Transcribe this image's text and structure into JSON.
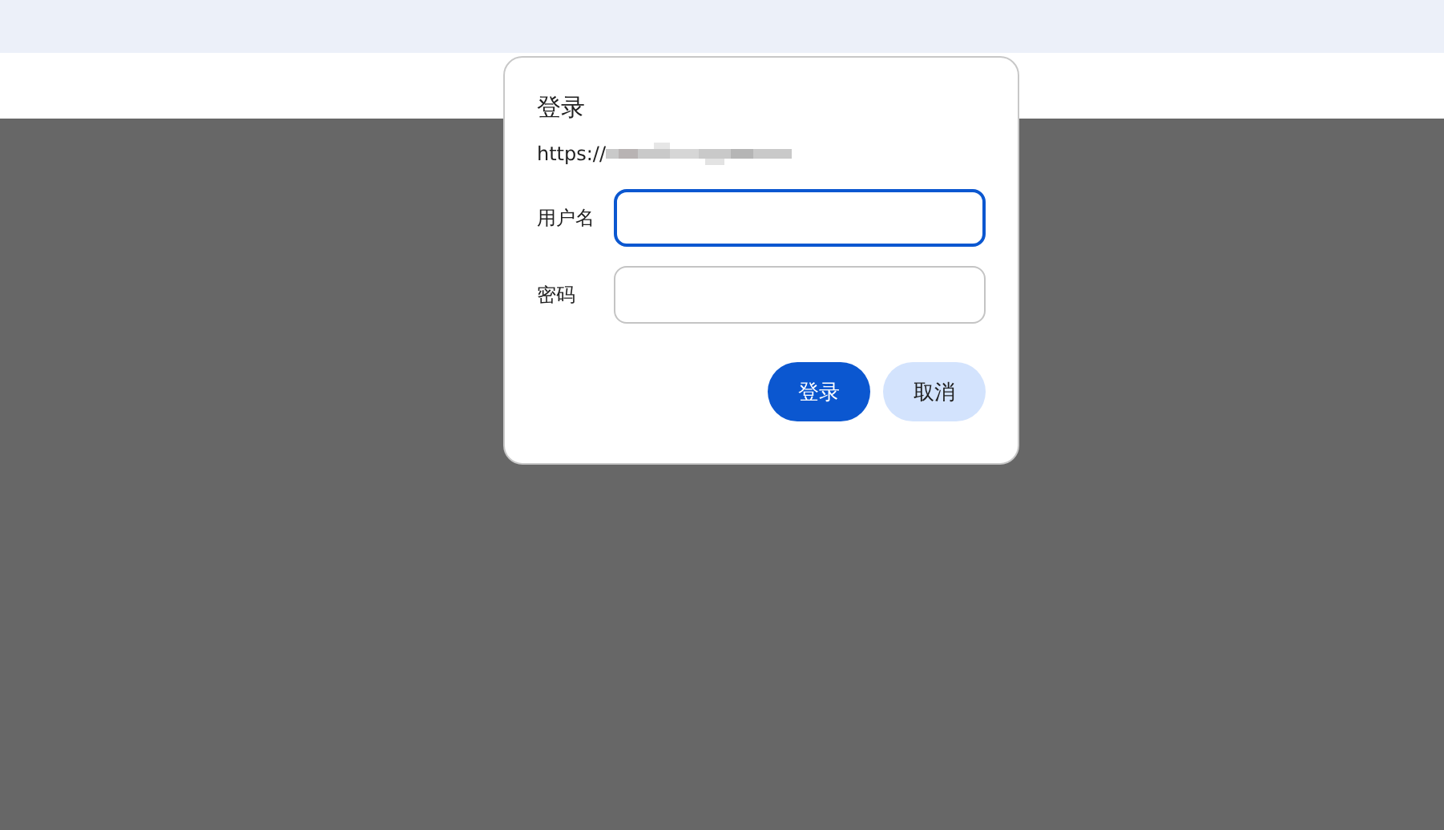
{
  "dialog": {
    "title": "登录",
    "url": "https://",
    "fields": [
      {
        "label": "用户名",
        "focused": true
      },
      {
        "label": "密码",
        "focused": false
      }
    ],
    "buttons": [
      {
        "label": "登录",
        "kind": "primary"
      },
      {
        "label": "取消",
        "kind": "secondary"
      }
    ]
  }
}
